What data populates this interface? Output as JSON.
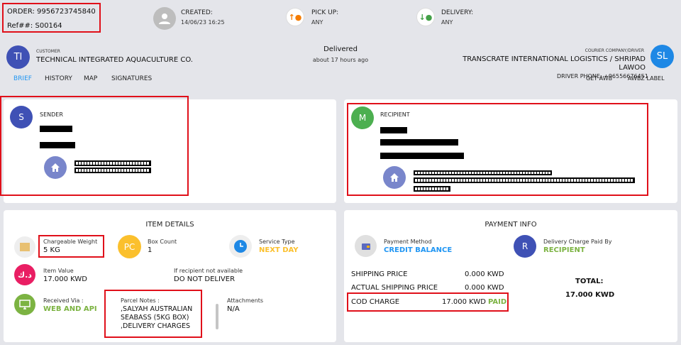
{
  "header": {
    "order_label": "ORDER: 9956723745840",
    "ref_label": "Ref##: S00164",
    "created_label": "CREATED:",
    "created_value": "14/06/23 16:25",
    "pickup_label": "PICK UP:",
    "pickup_value": "ANY",
    "delivery_label": "DELIVERY:",
    "delivery_value": "ANY"
  },
  "customer": {
    "initials": "TI",
    "caption": "CUSTOMER",
    "name": "TECHNICAL INTEGRATED AQUACULTURE CO."
  },
  "status": {
    "text": "Delivered",
    "time": "about 17 hours ago"
  },
  "courier": {
    "caption": "COURIER COMPANY/DRIVER",
    "name_line1": "TRANSCRATE INTERNATIONAL LOGISTICS / SHRIPAD",
    "name_line2": "LAWOO",
    "initials": "SL",
    "driver_phone": "DRIVER PHONE: +96556676451",
    "get_awb": "GET AWB",
    "awb_label": "AWBZ LABEL"
  },
  "tabs": [
    "BRIEF",
    "HISTORY",
    "MAP",
    "SIGNATURES"
  ],
  "sender": {
    "initial": "S",
    "title": "SENDER"
  },
  "recipient": {
    "initial": "M",
    "title": "RECIPIENT"
  },
  "item_details": {
    "title": "ITEM DETAILS",
    "chargeable_weight_label": "Chargeable Weight",
    "chargeable_weight_value": "5 KG",
    "box_count_icon": "PC",
    "box_count_label": "Box Count",
    "box_count_value": "1",
    "service_type_label": "Service Type",
    "service_type_value": "NEXT DAY",
    "item_value_label": "Item Value",
    "item_value_value": "17.000 KWD",
    "if_not_available_label": "If recipient not available",
    "if_not_available_value": "DO NOT DELIVER",
    "received_via_label": "Received Via :",
    "received_via_value": "WEB AND API",
    "parcel_notes_label": "Parcel Notes :",
    "parcel_notes_line1": ",SALYAH AUSTRALIAN",
    "parcel_notes_line2": "SEABASS (5KG BOX)",
    "parcel_notes_line3": ",DELIVERY CHARGES",
    "attachments_label": "Attachments",
    "attachments_value": "N/A"
  },
  "payment_info": {
    "title": "PAYMENT INFO",
    "payment_method_label": "Payment Method",
    "payment_method_value": "CREDIT BALANCE",
    "charge_paid_icon": "R",
    "charge_paid_label": "Delivery Charge Paid By",
    "charge_paid_value": "RECIPIENT",
    "shipping_price_label": "SHIPPING PRICE",
    "shipping_price_value": "0.000 KWD",
    "actual_shipping_label": "ACTUAL SHIPPING PRICE",
    "actual_shipping_value": "0.000 KWD",
    "cod_label": "COD CHARGE",
    "cod_value": "17.000 KWD",
    "cod_status": "PAID",
    "total_label": "TOTAL:",
    "total_value": "17.000 KWD"
  },
  "colors": {
    "accent_blue": "#2196f3",
    "green": "#7cb342",
    "highlight_red": "#e0101a",
    "avatar_indigo": "#3f51b5",
    "avatar_green": "#4caf50",
    "avatar_blue": "#1e88e5"
  }
}
